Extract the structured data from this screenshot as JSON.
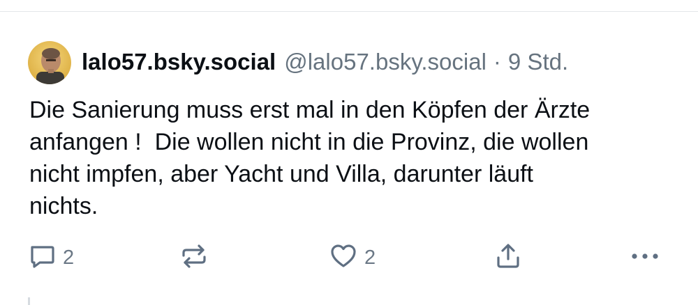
{
  "post": {
    "author": {
      "display_name": "lalo57.bsky.social",
      "handle": "@lalo57.bsky.social"
    },
    "separator": "·",
    "timestamp": "9 Std.",
    "text": "Die Sanierung muss erst mal in den Köpfen der Ärzte\nanfangen !  Die wollen nicht in die Provinz, die wollen\nnicht impfen, aber Yacht und Villa, darunter läuft\nnichts."
  },
  "actions": {
    "reply": {
      "icon": "reply-icon",
      "count": "2"
    },
    "repost": {
      "icon": "repost-icon"
    },
    "like": {
      "icon": "heart-icon",
      "count": "2"
    },
    "share": {
      "icon": "share-icon"
    },
    "more": {
      "icon": "more-icon"
    }
  },
  "colors": {
    "text": "#0b0f14",
    "muted": "#66737f",
    "icon": "#5f6f82",
    "divider": "#e3e6ea"
  }
}
